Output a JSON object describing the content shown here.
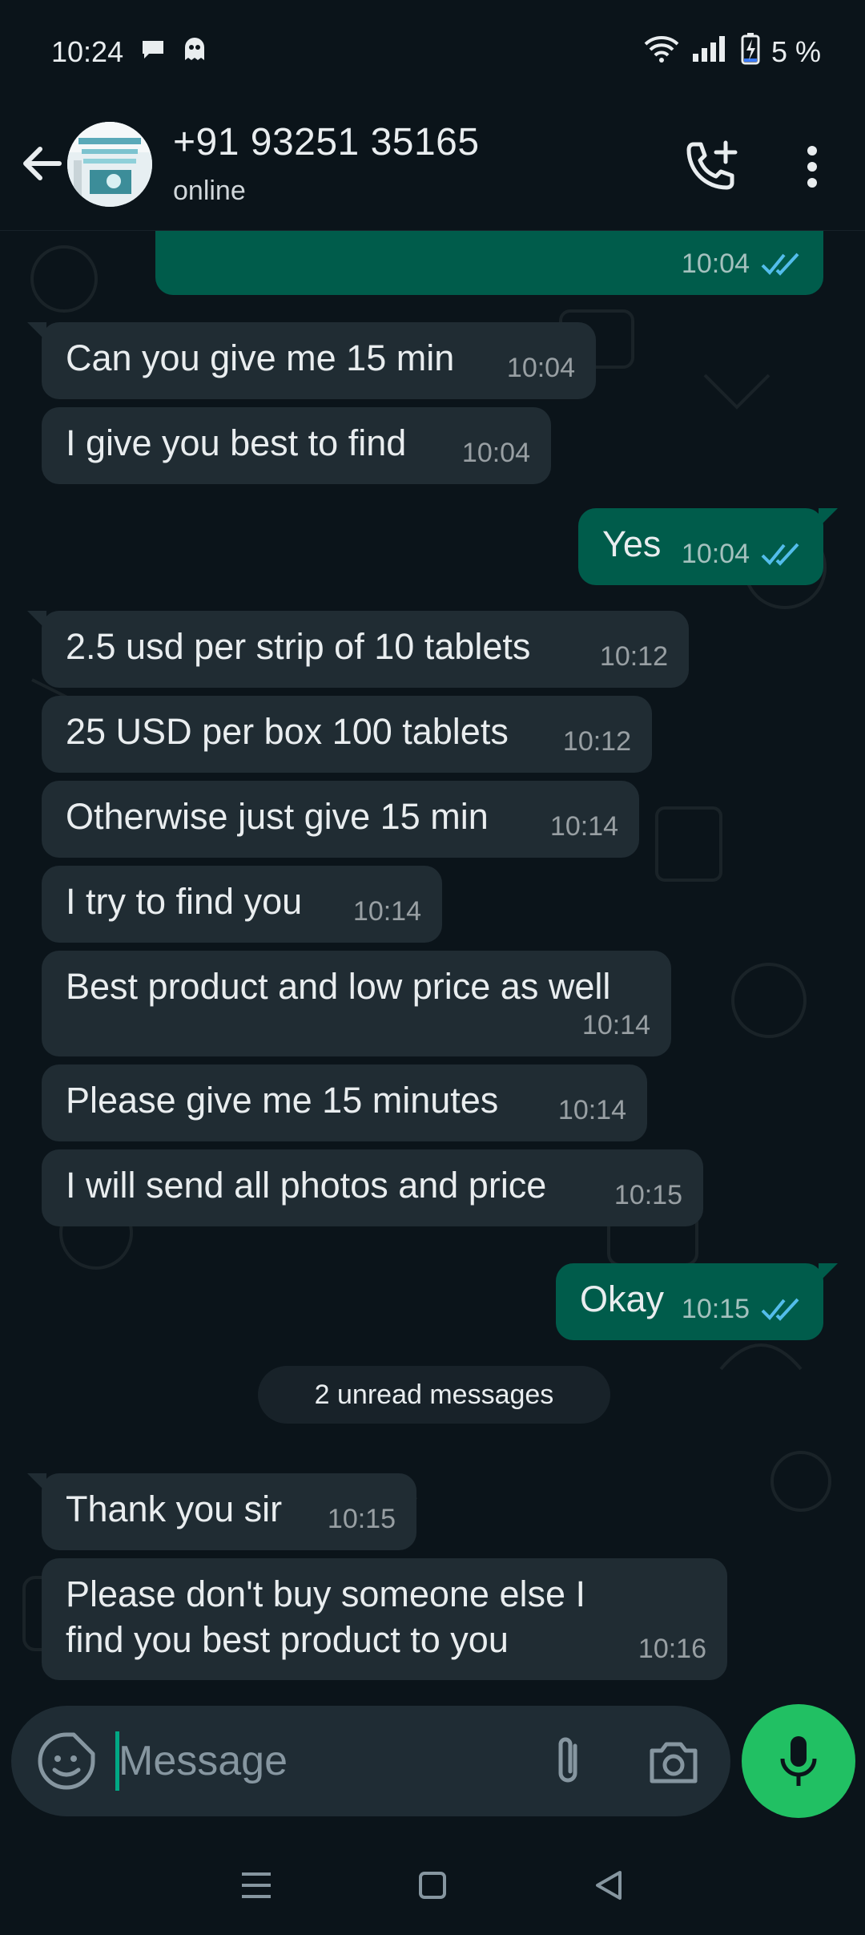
{
  "status_bar": {
    "time": "10:24",
    "battery": "5 %",
    "icons": [
      "message-notification-icon",
      "ghost-notification-icon",
      "wifi-icon",
      "signal-icon",
      "battery-charging-icon"
    ]
  },
  "header": {
    "contact_name": "+91 93251 35165",
    "contact_status": "online",
    "icons": [
      "back-arrow-icon",
      "add-call-icon",
      "more-vert-icon"
    ]
  },
  "messages": [
    {
      "dir": "out",
      "text": "",
      "time": "10:04",
      "read": true
    },
    {
      "dir": "in",
      "text": "Can you give me 15 min",
      "time": "10:04"
    },
    {
      "dir": "in",
      "text": "I give you best to find",
      "time": "10:04"
    },
    {
      "dir": "out",
      "text": "Yes",
      "time": "10:04",
      "read": true
    },
    {
      "dir": "in",
      "text": "2.5 usd per strip of 10 tablets",
      "time": "10:12"
    },
    {
      "dir": "in",
      "text": "25 USD per box 100 tablets",
      "time": "10:12"
    },
    {
      "dir": "in",
      "text": "Otherwise just give 15 min",
      "time": "10:14"
    },
    {
      "dir": "in",
      "text": "I try to find you",
      "time": "10:14"
    },
    {
      "dir": "in",
      "text": "Best product and low price as well",
      "time": "10:14"
    },
    {
      "dir": "in",
      "text": "Please give me 15 minutes",
      "time": "10:14"
    },
    {
      "dir": "in",
      "text": "I will send all photos and price",
      "time": "10:15"
    },
    {
      "dir": "out",
      "text": "Okay",
      "time": "10:15",
      "read": true
    },
    {
      "dir": "in",
      "text": "Thank you sir",
      "time": "10:15"
    },
    {
      "dir": "in",
      "text": "Please don't buy someone else I find you best product to you",
      "time": "10:16"
    }
  ],
  "unread_banner": "2 unread messages",
  "composer": {
    "placeholder": "Message",
    "icons": [
      "sticker-icon",
      "paperclip-icon",
      "camera-icon",
      "microphone-icon"
    ]
  },
  "colors": {
    "background": "#0b141a",
    "incoming_bubble": "#202c33",
    "outgoing_bubble": "#005c4b",
    "accent": "#21c063",
    "read_ticks": "#53bdeb"
  }
}
